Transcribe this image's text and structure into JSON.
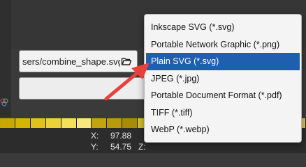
{
  "path_field": {
    "value": "sers/combine_shape.svg"
  },
  "format_menu": {
    "selected_index": 2,
    "options": [
      "Inkscape SVG (*.svg)",
      "Portable Network Graphic (*.png)",
      "Plain SVG (*.svg)",
      "JPEG (*.jpg)",
      "Portable Document Format (*.pdf)",
      "TIFF (*.tiff)",
      "WebP (*.webp)"
    ]
  },
  "status": {
    "x_label": "X:",
    "x_value": "97.88",
    "y_label": "Y:",
    "y_value": "54.75",
    "zoom_label": "Z:"
  },
  "colors": {
    "accent": "#1f5fb0",
    "arrow": "#e8413a",
    "palette": [
      "#c8a800",
      "#d6b500",
      "#e0c21a",
      "#ead238",
      "#f2df5a",
      "#f7e77c",
      "#c2a410",
      "#b89a0c",
      "#a88c08",
      "#d9bf30",
      "#ecd860",
      "#f5e48a",
      "#fbeead",
      "#cdb23a",
      "#bda32e",
      "#e4cc4a",
      "#f0db6e",
      "#a68a1c",
      "#8f7a1e",
      "#dcc554"
    ]
  }
}
